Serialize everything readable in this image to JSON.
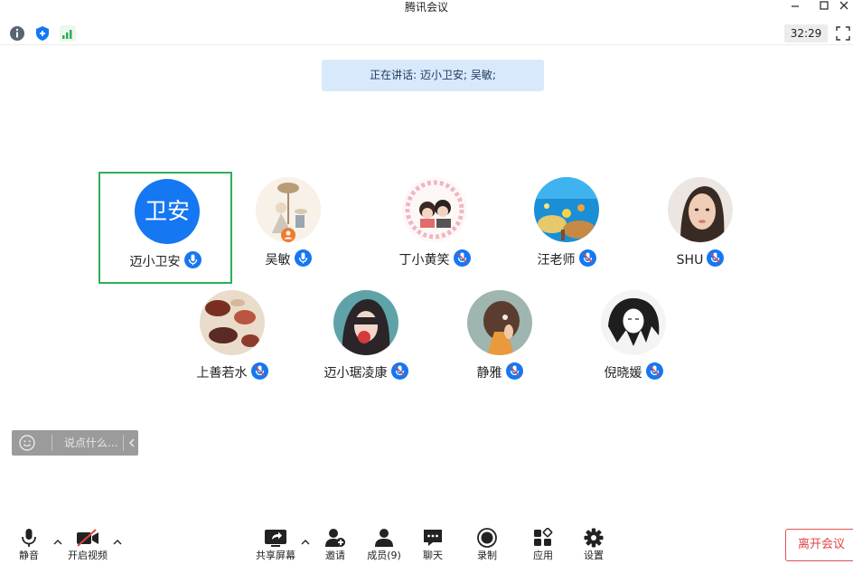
{
  "window": {
    "title": "腾讯会议",
    "controls": [
      "minimize-icon",
      "maximize-icon",
      "close-icon"
    ]
  },
  "status": {
    "icons": [
      "info-icon",
      "shield-icon",
      "signal-icon"
    ],
    "timer": "32:29"
  },
  "speaking": {
    "text": "正在讲话: 迈小卫安; 吴敏;"
  },
  "participants": [
    {
      "name": "迈小卫安",
      "initials": "卫安",
      "active": true
    },
    {
      "name": "吴敏"
    },
    {
      "name": "丁小黄笑"
    },
    {
      "name": "汪老师"
    },
    {
      "name": "SHU"
    },
    {
      "name": "上善若水"
    },
    {
      "name": "迈小琚凌康"
    },
    {
      "name": "静雅"
    },
    {
      "name": "倪晓媛"
    }
  ],
  "chat": {
    "placeholder": "说点什么..."
  },
  "toolbar": {
    "mute": "静音",
    "video": "开启视频",
    "share": "共享屏幕",
    "invite": "邀请",
    "members": "成员(9)",
    "chat": "聊天",
    "record": "录制",
    "apps": "应用",
    "settings": "设置",
    "leave": "离开会议"
  },
  "colors": {
    "accent": "#1577f2",
    "active_border": "#2bb15a",
    "leave": "#e04444",
    "banner": "#d8e9fb"
  }
}
